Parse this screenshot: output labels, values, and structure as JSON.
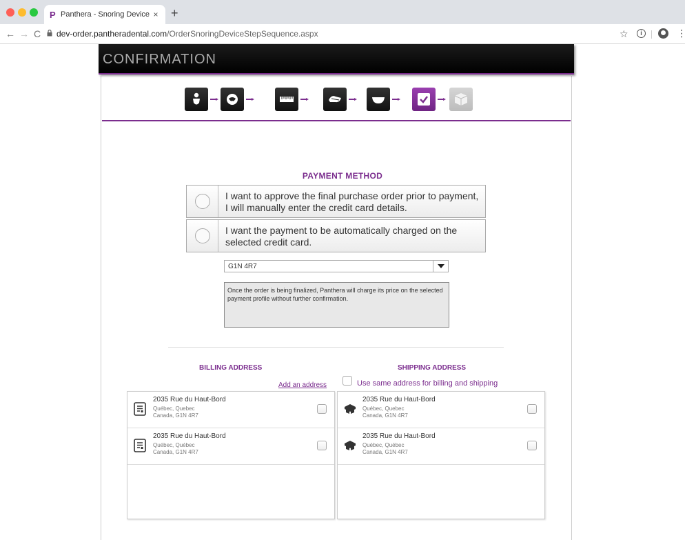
{
  "browser": {
    "tab_title": "Panthera - Snoring Device Order",
    "tab_favicon": "P",
    "tab_close": "×",
    "new_tab": "+",
    "url_domain": "dev-order.pantheradental.com",
    "url_path": "/OrderSnoringDeviceStepSequence.aspx",
    "nav": {
      "back": "←",
      "forward": "→",
      "reload": "C"
    },
    "star": "☆",
    "info": "i",
    "menu": "⋮"
  },
  "header": {
    "title": "CONFIRMATION"
  },
  "steps": [
    {
      "icon": "person-icon",
      "state": "done"
    },
    {
      "icon": "tooth-icon",
      "state": "done"
    },
    {
      "icon": "ruler-icon",
      "state": "done"
    },
    {
      "icon": "mouthguard-icon",
      "state": "done"
    },
    {
      "icon": "tray-icon",
      "state": "done"
    },
    {
      "icon": "checkmark-icon",
      "state": "active"
    },
    {
      "icon": "box-icon",
      "state": "disabled"
    }
  ],
  "payment": {
    "title": "PAYMENT METHOD",
    "option1": "I want to approve the final purchase order prior to payment, I will manually enter the credit card details.",
    "option2": "I want the payment to be automatically charged on the selected credit card.",
    "selected_profile": "G1N 4R7",
    "note": "Once the order is being finalized, Panthera will charge its price on the selected payment profile without further confirmation."
  },
  "billing": {
    "title": "BILLING ADDRESS",
    "add_link": "Add an address",
    "addresses": [
      {
        "line1": "2035 Rue du Haut-Bord",
        "line2": "Québec, Quebec",
        "line3": "Canada, G1N 4R7"
      },
      {
        "line1": "2035 Rue du Haut-Bord",
        "line2": "Québec, Québec",
        "line3": "Canada, G1N 4R7"
      }
    ]
  },
  "shipping": {
    "title": "SHIPPING ADDRESS",
    "same_label": "Use same address for billing and shipping",
    "addresses": [
      {
        "line1": "2035 Rue du Haut-Bord",
        "line2": "Québec, Quebec",
        "line3": "Canada, G1N 4R7"
      },
      {
        "line1": "2035 Rue du Haut-Bord",
        "line2": "Québec, Québec",
        "line3": "Canada, G1N 4R7"
      }
    ]
  },
  "colors": {
    "accent": "#7b2d8e",
    "header_bg": "#000000"
  }
}
